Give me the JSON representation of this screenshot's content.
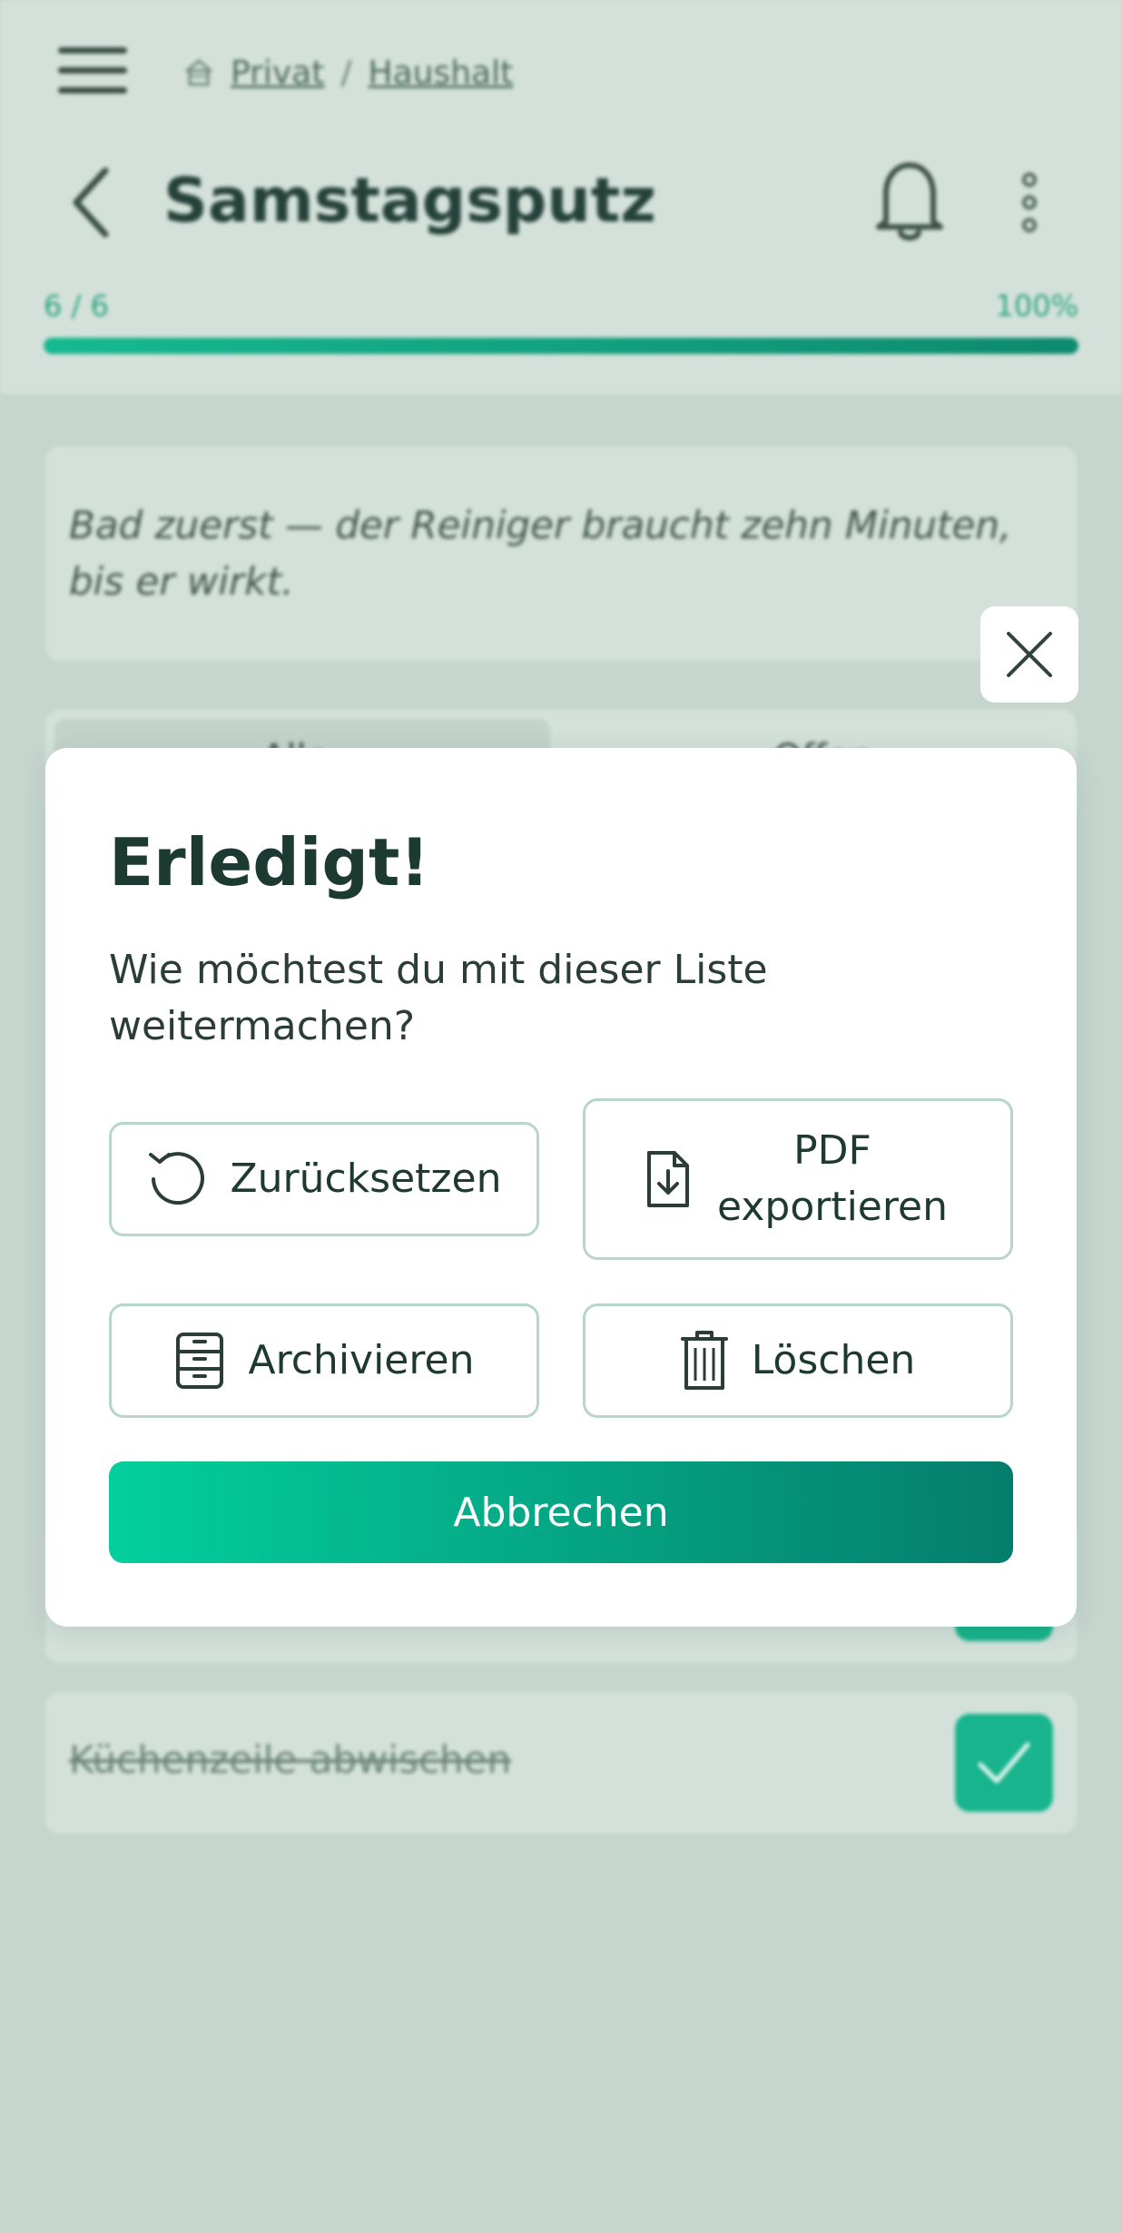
{
  "header": {
    "breadcrumb": [
      {
        "label": "Privat"
      },
      {
        "label": "Haushalt"
      }
    ],
    "breadcrumb_separator": "/",
    "title": "Samstagsputz",
    "progress_count": "6 / 6",
    "progress_percent_label": "100%",
    "progress_fraction": 1.0
  },
  "note": {
    "text": "Bad zuerst — der Reiniger braucht zehn Minuten, bis er wirkt."
  },
  "filters": {
    "tab_all": "Alle",
    "tab_open": "Offen"
  },
  "tasks": [
    {
      "text": "Küchenzeile abwischen",
      "done": true
    }
  ],
  "dialog": {
    "title": "Erledigt!",
    "message": "Wie möchtest du mit dieser Liste weitermachen?",
    "reset_label": "Zurücksetzen",
    "pdf_label": "PDF exportieren",
    "archive_label": "Archivieren",
    "delete_label": "Löschen",
    "cancel_label": "Abbrechen"
  },
  "colors": {
    "accent_start": "#03cf9d",
    "accent_end": "#057d6d",
    "border": "#b5d6c9",
    "text_dark": "#1c3a31"
  },
  "icons": {
    "menu": "hamburger-icon",
    "home": "home-icon",
    "back": "chevron-left-icon",
    "notifications": "bell-icon",
    "more": "kebab-icon",
    "close": "close-icon",
    "reset": "refresh-icon",
    "pdf": "file-download-icon",
    "archive": "cabinet-icon",
    "delete": "trash-icon",
    "check": "check-icon"
  }
}
